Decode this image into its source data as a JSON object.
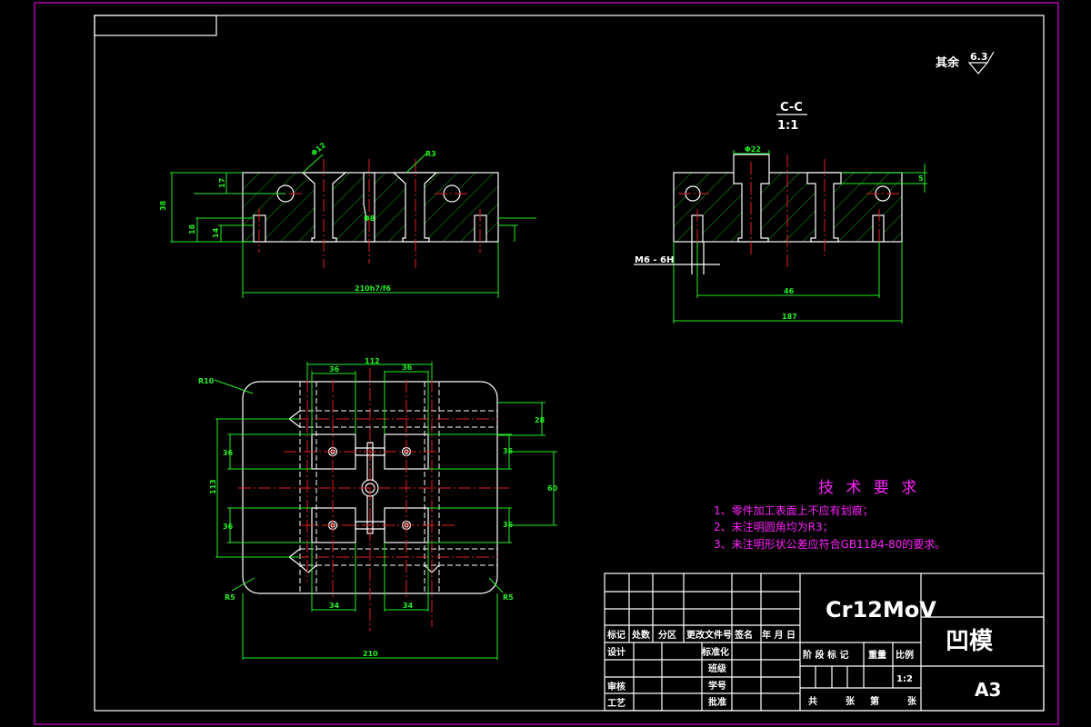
{
  "colors": {
    "background": "#000000",
    "outer_border": "#ff00ff",
    "outline": "#ffffff",
    "dimension": "#22ee22",
    "centerline": "#e02020",
    "notes": "#ff22ff"
  },
  "surface_finish": {
    "label": "其余",
    "value": "6.3"
  },
  "section_view": {
    "name": "C-C",
    "scale": "1:1",
    "thread_label": "M6 - 6H",
    "dims": {
      "width": "187",
      "hole_spacing": "46",
      "counterbore": "Φ22",
      "depth": "5"
    }
  },
  "front_view": {
    "dims": {
      "length": "210h7/f6",
      "height": "38",
      "d1": "17",
      "d2": "18",
      "d3": "14",
      "hole": "Φ12",
      "r": "R3",
      "mid": "Φ8"
    }
  },
  "plan_view": {
    "dims": {
      "corner_top": "R10",
      "corner_bl": "R5",
      "corner_br": "R5",
      "span_top": "112",
      "cav_w1": "36",
      "cav_w2": "36",
      "cav_b1": "34",
      "cav_b2": "34",
      "total_w": "210",
      "pin_span": "113",
      "cav_h1": "36",
      "cav_h2": "36",
      "right_h1": "36",
      "right_h2": "36",
      "right_span": "60",
      "top_off": "28"
    }
  },
  "tech_requirements": {
    "title": "技 术 要 求",
    "items": [
      "1、零件加工表面上不应有划痕；",
      "2、未注明圆角均为R3；",
      "3、未注明形状公差应符合GB1184-80的要求。"
    ]
  },
  "title_block": {
    "material": "Cr12MoV",
    "part_name": "凹模",
    "sheet_size": "A3",
    "header": [
      "标记",
      "处数",
      "分区",
      "更改文件号",
      "签名",
      "年 月 日"
    ],
    "left_rows": [
      "设计",
      "",
      "审核",
      "工艺"
    ],
    "mid_rows": [
      "标准化",
      "班级",
      "学号",
      "批准"
    ],
    "stage_label": "阶 段 标 记",
    "weight_label": "重量",
    "scale_label": "比例",
    "scale_value": "1:2",
    "sheets": [
      "共",
      "张",
      "第",
      "张"
    ]
  }
}
